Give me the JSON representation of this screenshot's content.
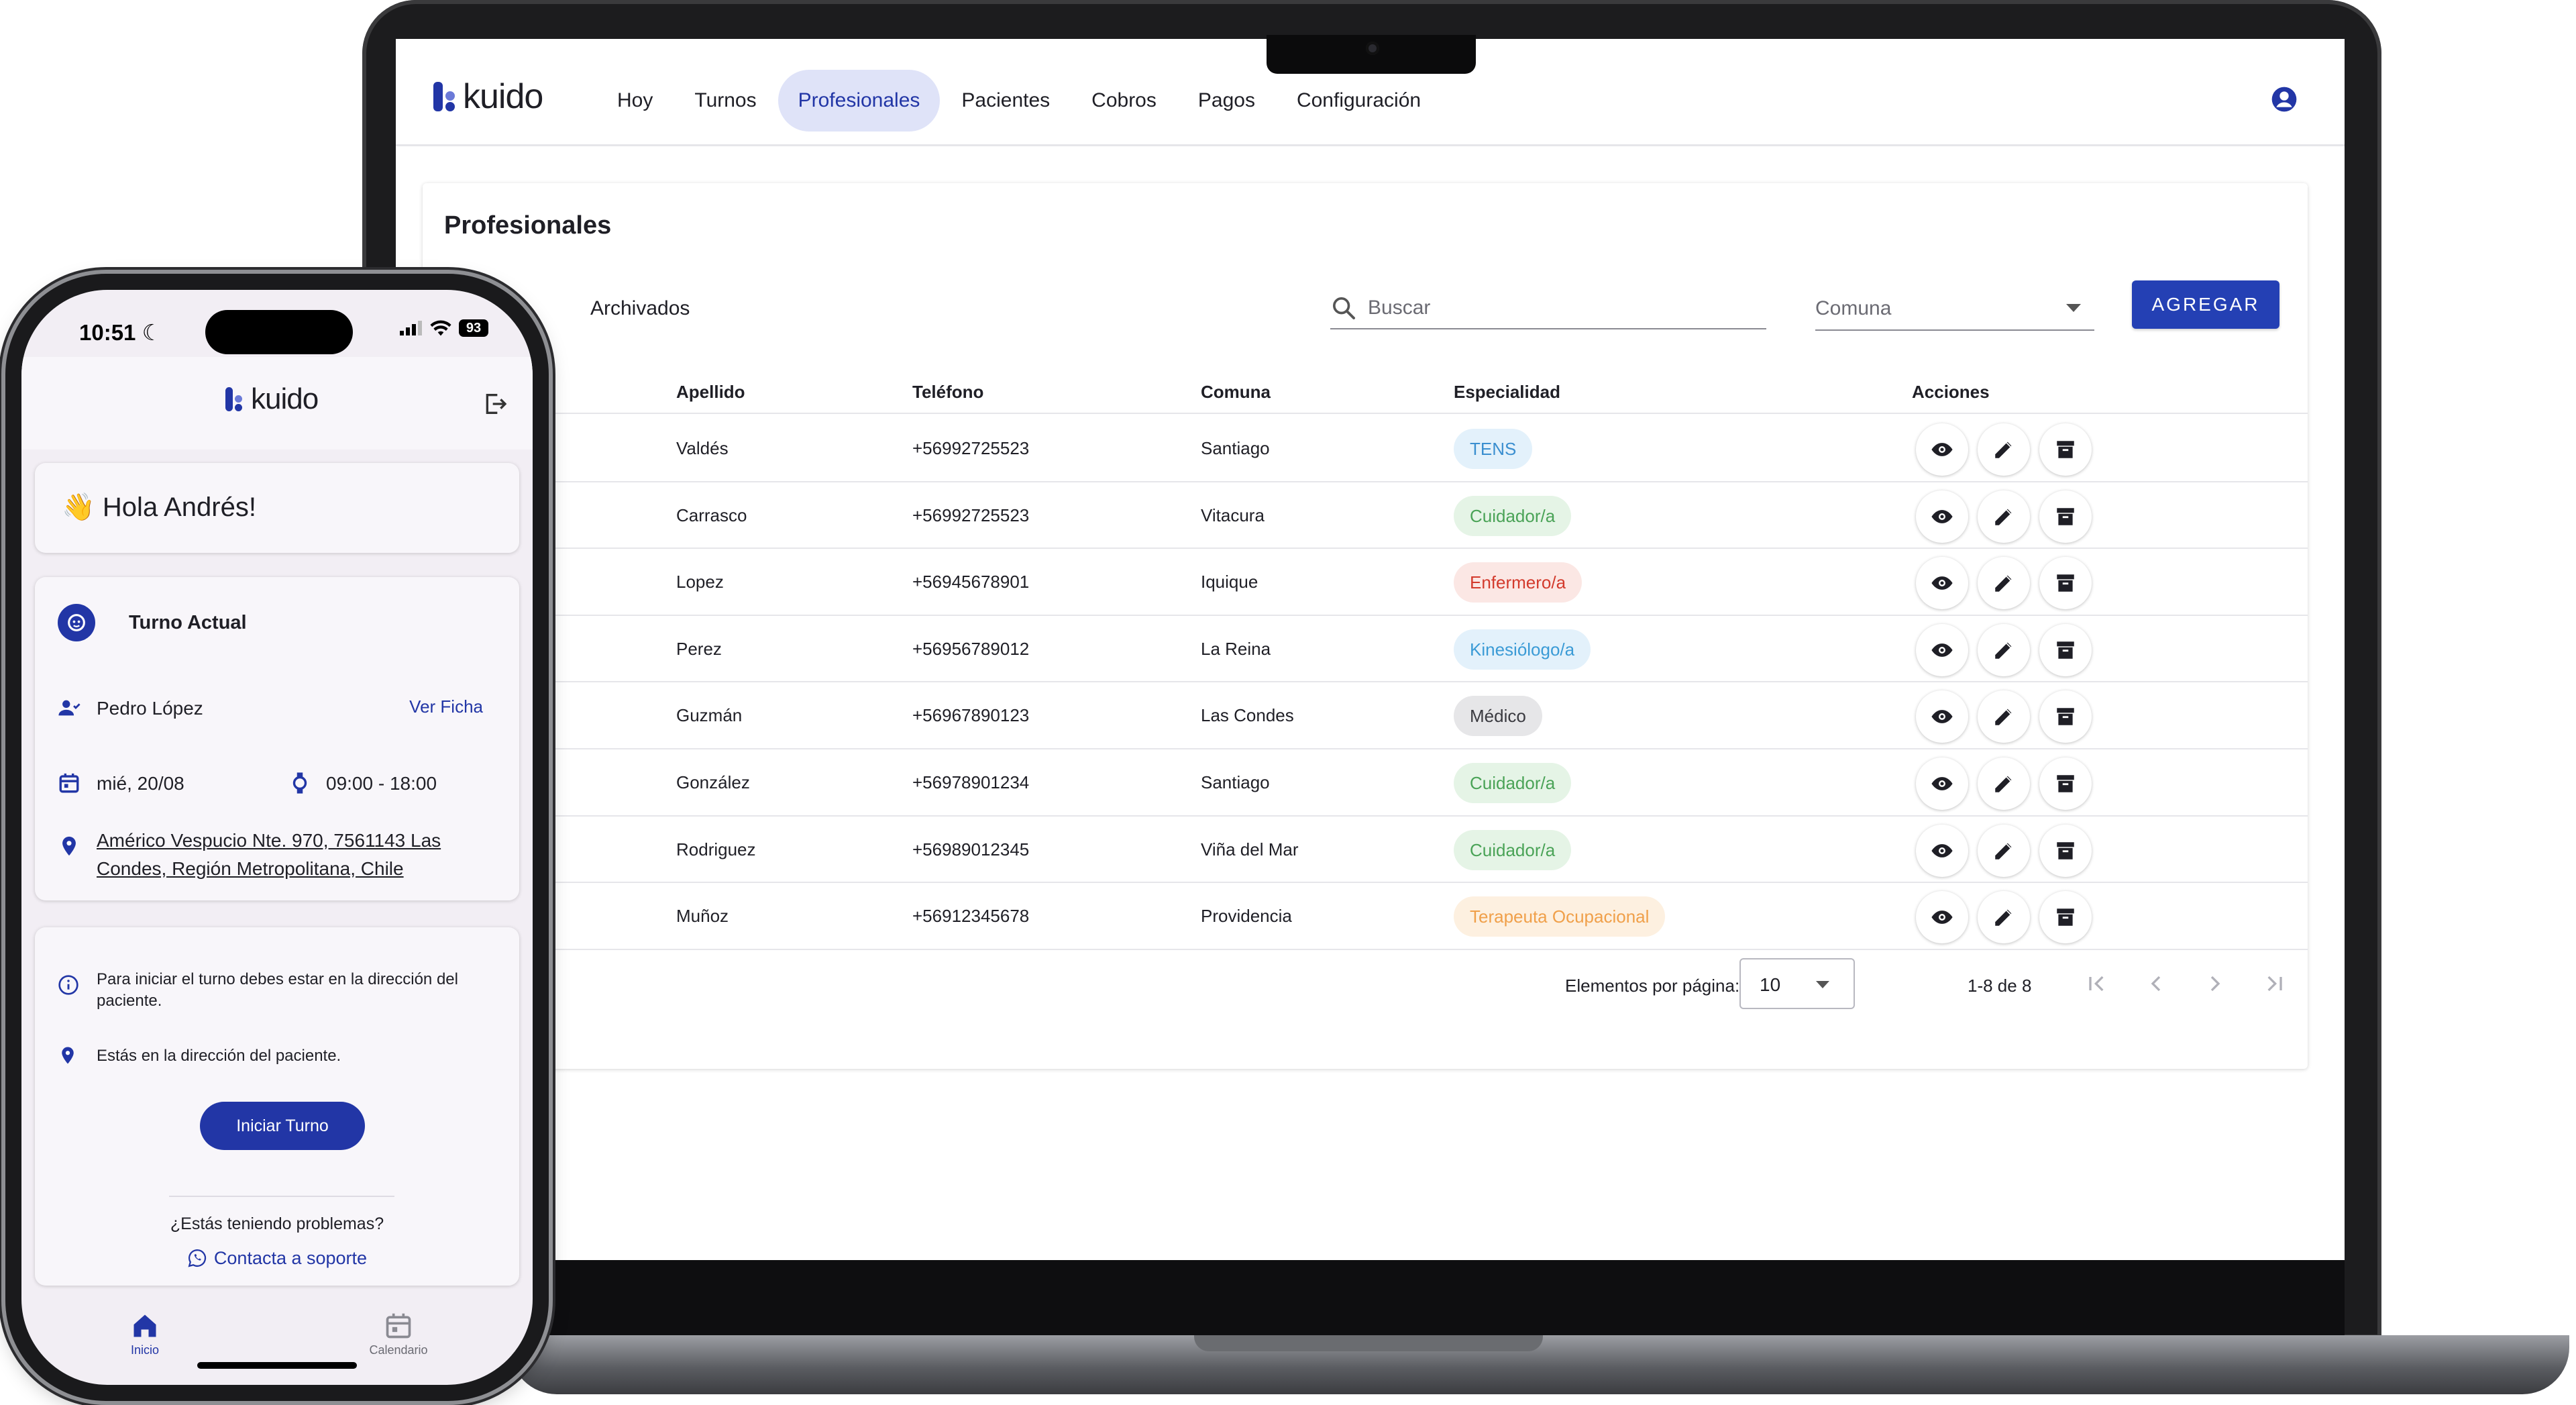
{
  "laptop": {
    "brand": "kuido",
    "nav": [
      "Hoy",
      "Turnos",
      "Profesionales",
      "Pacientes",
      "Cobros",
      "Pagos",
      "Configuración"
    ],
    "active_nav": "Profesionales",
    "page_title": "Profesionales",
    "tab_archived": "Archivados",
    "search": {
      "placeholder": "Buscar",
      "value": ""
    },
    "filter": {
      "label": "Comuna"
    },
    "add_button": "AGREGAR",
    "table": {
      "columns": [
        "Apellido",
        "Teléfono",
        "Comuna",
        "Especialidad",
        "Acciones"
      ],
      "rows": [
        {
          "apellido": "Valdés",
          "telefono": "+56992725523",
          "comuna": "Santiago",
          "especialidad": "TENS"
        },
        {
          "apellido": "Carrasco",
          "telefono": "+56992725523",
          "comuna": "Vitacura",
          "especialidad": "Cuidador/a"
        },
        {
          "apellido": "Lopez",
          "telefono": "+56945678901",
          "comuna": "Iquique",
          "especialidad": "Enfermero/a"
        },
        {
          "apellido": "Perez",
          "telefono": "+56956789012",
          "comuna": "La Reina",
          "especialidad": "Kinesiólogo/a"
        },
        {
          "apellido": "Guzmán",
          "telefono": "+56967890123",
          "comuna": "Las Condes",
          "especialidad": "Médico"
        },
        {
          "apellido": "González",
          "telefono": "+56978901234",
          "comuna": "Santiago",
          "especialidad": "Cuidador/a"
        },
        {
          "apellido": "Rodriguez",
          "telefono": "+56989012345",
          "comuna": "Viña del Mar",
          "especialidad": "Cuidador/a"
        },
        {
          "apellido": "Muñoz",
          "telefono": "+56912345678",
          "comuna": "Providencia",
          "especialidad": "Terapeuta Ocupacional"
        }
      ]
    },
    "pagination": {
      "label": "Elementos por página:",
      "per_page": "10",
      "range": "1-8 de 8"
    },
    "colors": {
      "accent": "#2236a6",
      "chips": {
        "TENS": {
          "bg": "#e3f1fb",
          "fg": "#3b8fd0"
        },
        "Cuidador/a": {
          "bg": "#e5f4e6",
          "fg": "#4aa357"
        },
        "Enfermero/a": {
          "bg": "#fbe7e4",
          "fg": "#d33a2c"
        },
        "Kinesiólogo/a": {
          "bg": "#e3f1fb",
          "fg": "#3b9bd6"
        },
        "Médico": {
          "bg": "#e6e6e8",
          "fg": "#3a3a40"
        },
        "Terapeuta Ocupacional": {
          "bg": "#fdf0e0",
          "fg": "#f0a04a"
        }
      }
    }
  },
  "phone": {
    "status": {
      "time": "10:51",
      "battery": "93"
    },
    "brand": "kuido",
    "greeting": "👋 Hola Andrés!",
    "shift": {
      "title": "Turno Actual",
      "patient": "Pedro López",
      "view_link": "Ver Ficha",
      "date": "mié, 20/08",
      "time": "09:00 - 18:00",
      "address": "Américo Vespucio Nte. 970, 7561143 Las Condes, Región Metropolitana, Chile"
    },
    "info": {
      "notice": "Para iniciar el turno debes estar en la dirección del paciente.",
      "location_ok": "Estás en la dirección del paciente.",
      "start_button": "Iniciar Turno",
      "problems": "¿Estás teniendo problemas?",
      "support_link": "Contacta a soporte"
    },
    "tabs": [
      {
        "label": "Inicio",
        "active": true
      },
      {
        "label": "Calendario",
        "active": false
      }
    ]
  }
}
